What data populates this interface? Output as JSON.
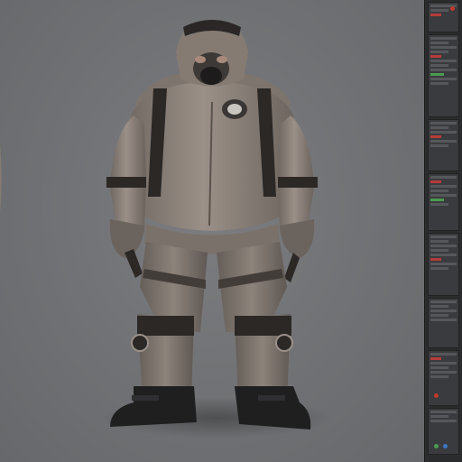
{
  "app": {
    "title": ""
  },
  "viewport": {
    "background_color": "#707174",
    "subject": "hazmat-suit-character-model"
  },
  "side_panel": {
    "blocks": [
      {
        "name": "panel-block-1",
        "accent": "#c0392b"
      },
      {
        "name": "panel-block-2",
        "accent": "#3b78c4"
      },
      {
        "name": "panel-block-3",
        "accent": "#c0392b"
      },
      {
        "name": "panel-block-4",
        "accent": "#4b9b4f"
      },
      {
        "name": "panel-block-5",
        "accent": "#c0392b"
      },
      {
        "name": "panel-block-6",
        "accent": "#3b78c4"
      },
      {
        "name": "panel-block-7",
        "accent": "#c0392b"
      },
      {
        "name": "panel-block-8",
        "accent": "#4b9b4f"
      }
    ]
  },
  "colors": {
    "suit": "#8f857d",
    "suit_shadow": "#5e5752",
    "straps": "#2b2826",
    "boots": "#1f1f20",
    "panel_bg": "#2b2c2e"
  }
}
